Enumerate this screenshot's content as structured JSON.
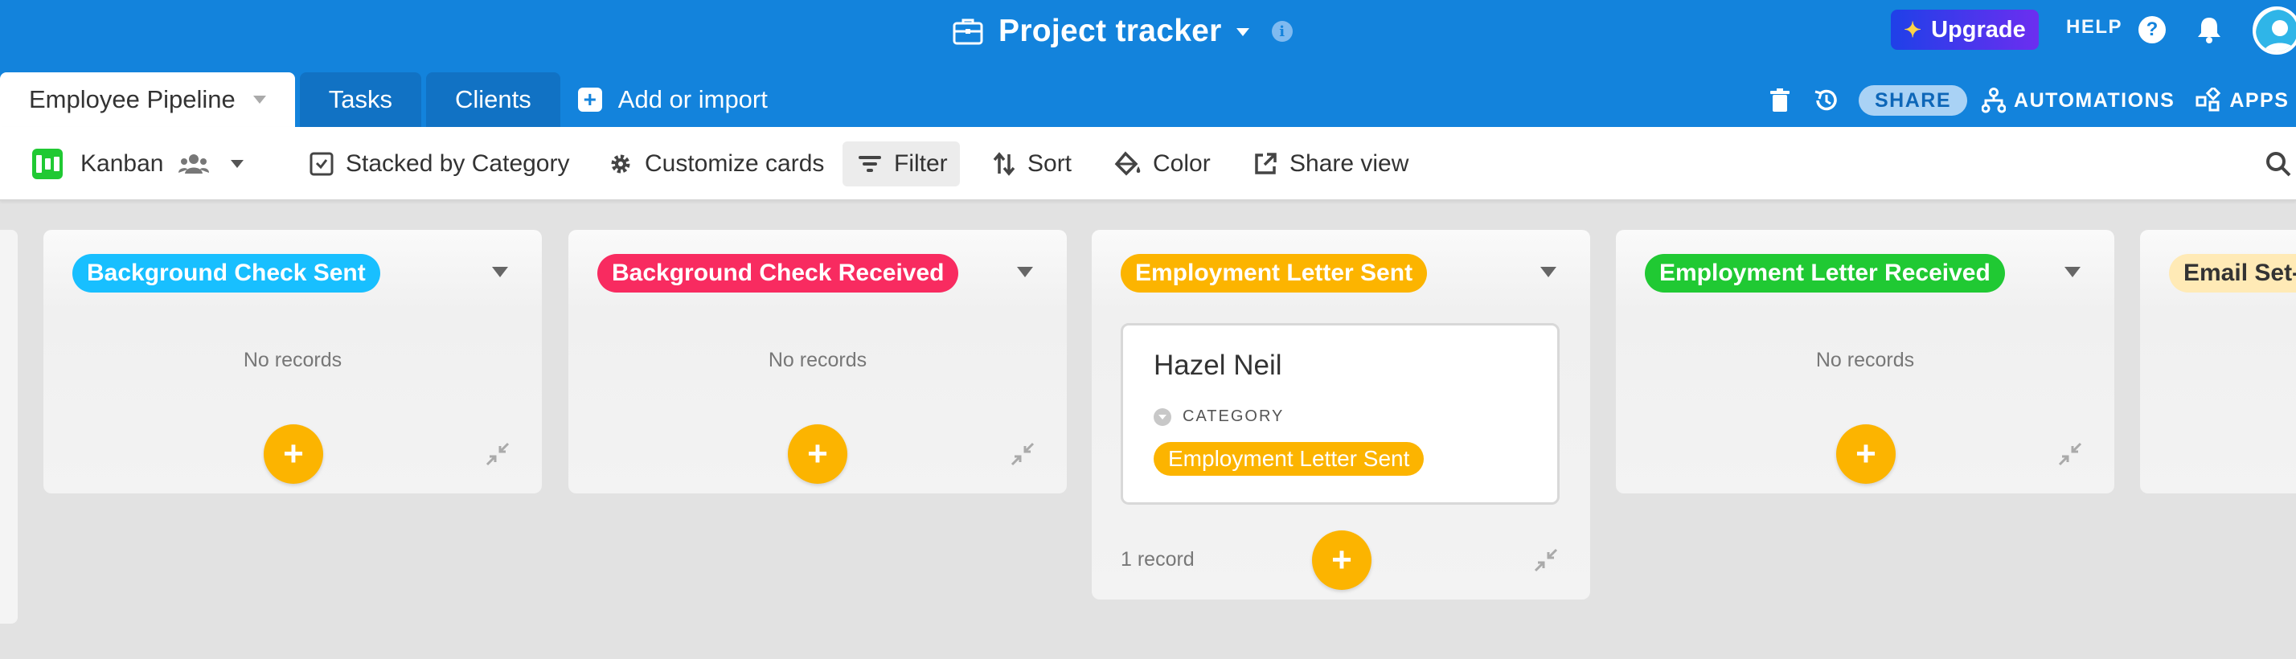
{
  "header": {
    "title": "Project tracker",
    "upgrade_label": "Upgrade",
    "help_label": "HELP"
  },
  "tabs": [
    {
      "label": "Employee Pipeline",
      "active": true
    },
    {
      "label": "Tasks",
      "active": false
    },
    {
      "label": "Clients",
      "active": false
    }
  ],
  "add_import_label": "Add or import",
  "right_tools": {
    "share_label": "SHARE",
    "automations_label": "AUTOMATIONS",
    "apps_label": "APPS"
  },
  "viewbar": {
    "view_name": "Kanban",
    "stacked_label": "Stacked by Category",
    "customize_label": "Customize cards",
    "filter_label": "Filter",
    "sort_label": "Sort",
    "color_label": "Color",
    "share_view_label": "Share view"
  },
  "columns": [
    {
      "title": "Background Check Sent",
      "color": "#18bfff",
      "empty_label": "No records"
    },
    {
      "title": "Background Check Received",
      "color": "#f82b60",
      "empty_label": "No records"
    },
    {
      "title": "Employment Letter Sent",
      "color": "#fcb400",
      "count_label": "1 record",
      "card": {
        "name": "Hazel Neil",
        "field_label": "CATEGORY",
        "field_value": "Employment Letter Sent"
      }
    },
    {
      "title": "Employment Letter Received",
      "color": "#20c933",
      "empty_label": "No records"
    },
    {
      "title": "Email Set-",
      "color": "#ffeab6"
    }
  ],
  "colors": {
    "brand_blue": "#1383dc",
    "add_button": "#fcb400"
  },
  "icons": [
    "briefcase-icon",
    "info-icon",
    "sparkle-icon",
    "help-icon",
    "bell-icon",
    "avatar",
    "plus-icon",
    "trash-icon",
    "history-icon",
    "automations-icon",
    "apps-icon",
    "kanban-icon",
    "people-icon",
    "stack-icon",
    "gear-icon",
    "filter-icon",
    "sort-icon",
    "paint-bucket-icon",
    "share-icon",
    "search-icon",
    "shrink-icon"
  ]
}
